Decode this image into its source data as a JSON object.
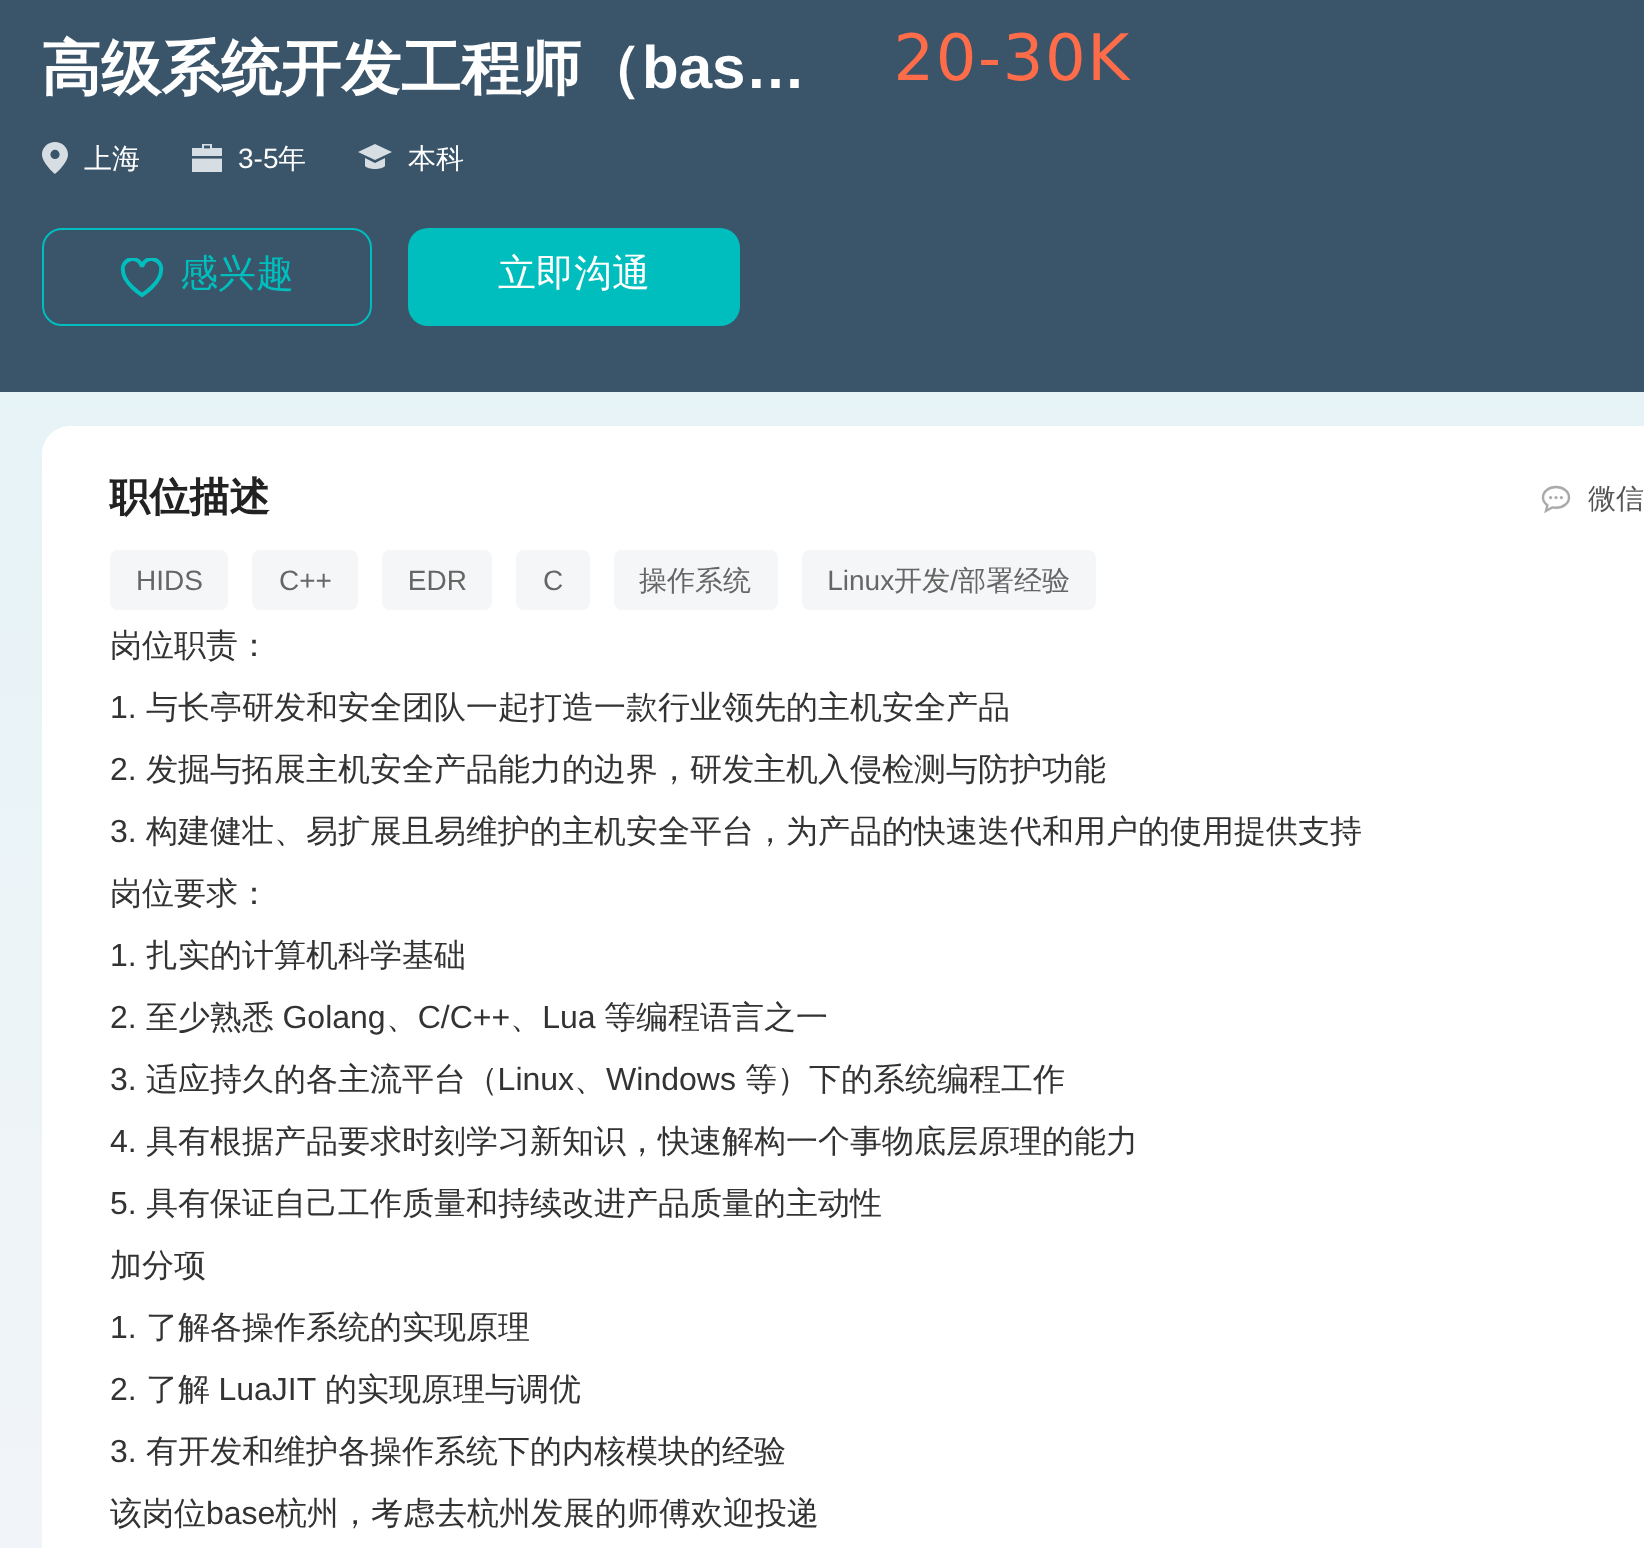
{
  "job": {
    "title": "高级系统开发工程师（bas…",
    "salary": "20-30K",
    "meta": [
      {
        "kind": "location",
        "text": "上海"
      },
      {
        "kind": "experience",
        "text": "3-5年"
      },
      {
        "kind": "degree",
        "text": "本科"
      }
    ],
    "interest_button": "感兴趣",
    "chat_button": "立即沟通"
  },
  "description": {
    "heading": "职位描述",
    "share": "微信",
    "tags": [
      "HIDS",
      "C++",
      "EDR",
      "C",
      "操作系统",
      "Linux开发/部署经验"
    ],
    "lines": [
      "岗位职责：",
      "1. 与长亭研发和安全团队一起打造一款行业领先的主机安全产品",
      "2. 发掘与拓展主机安全产品能力的边界，研发主机入侵检测与防护功能",
      "3. 构建健壮、易扩展且易维护的主机安全平台，为产品的快速迭代和用户的使用提供支持",
      "岗位要求：",
      "1. 扎实的计算机科学基础",
      "2. 至少熟悉 Golang、C/C++、Lua 等编程语言之一",
      "3. 适应持久的各主流平台（Linux、Windows 等）下的系统编程工作",
      "4. 具有根据产品要求时刻学习新知识，快速解构一个事物底层原理的能力",
      "5. 具有保证自己工作质量和持续改进产品质量的主动性",
      "加分项",
      "1. 了解各操作系统的实现原理",
      "2. 了解 LuaJIT 的实现原理与调优",
      "3. 有开发和维护各操作系统下的内核模块的经验",
      "该岗位base杭州，考虑去杭州发展的师傅欢迎投递"
    ]
  }
}
